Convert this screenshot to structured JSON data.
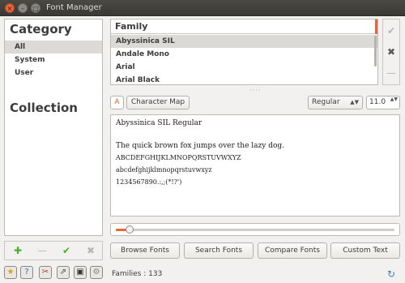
{
  "window": {
    "title": "Font Manager",
    "close_glyph": "×",
    "min_glyph": "–",
    "max_glyph": "□"
  },
  "sidebar": {
    "category_heading": "Category",
    "categories": [
      "All",
      "System",
      "User"
    ],
    "collection_heading": "Collection"
  },
  "sidebar_toolbar": {
    "add_glyph": "✚",
    "remove_glyph": "—",
    "apply_glyph": "✔",
    "clear_glyph": "✖"
  },
  "bottom_icons": [
    "star-icon",
    "help-icon",
    "preferences-icon",
    "export-icon",
    "save-icon",
    "manage-icon"
  ],
  "bottom_glyphs": [
    "★",
    "?",
    "✂",
    "⇗",
    "▣",
    "⚙"
  ],
  "family_list": {
    "header": "Family",
    "rows": [
      "Abyssinica SIL",
      "Andale Mono",
      "Arial",
      "Arial Black"
    ]
  },
  "right_tools": {
    "check_glyph": "✔",
    "remove_glyph": "✖",
    "minus_glyph": "—"
  },
  "handle": "····",
  "preview_controls": {
    "charmap_icon": "A",
    "character_map": "Character Map",
    "style": "Regular",
    "style_arrow": "▲▼",
    "size": "11.0",
    "size_arrow": "▲▼"
  },
  "preview": {
    "font_name": "Abyssinica SIL Regular",
    "sentence": "The quick brown fox jumps over the lazy dog.",
    "uppercase": "ABCDEFGHIJKLMNOPQRSTUVWXYZ",
    "lowercase": "abcdefghijklmnopqrstuvwxyz",
    "digits": "1234567890.:,;(*!?')"
  },
  "slider": {
    "value_fraction": 0.05
  },
  "tabs": [
    "Browse Fonts",
    "Search Fonts",
    "Compare Fonts",
    "Custom Text"
  ],
  "status": {
    "families": "Families : 133",
    "refresh_glyph": "↻"
  },
  "colors": {
    "accent": "#e8643a",
    "selection": "#dcdad6",
    "add_green": "#4caf2a"
  }
}
